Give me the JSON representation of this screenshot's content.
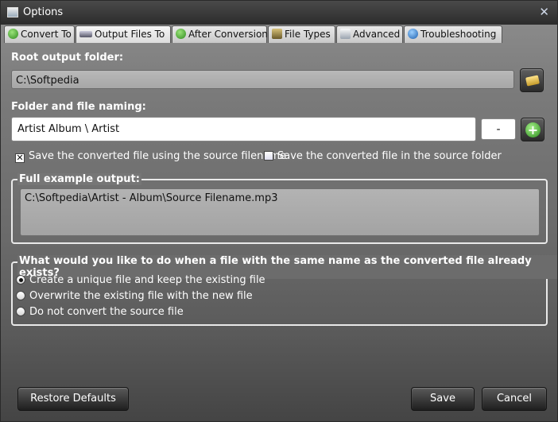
{
  "window": {
    "title": "Options",
    "close_glyph": "✕"
  },
  "tabs": [
    {
      "label": "Convert To",
      "icon": "green-check-icon"
    },
    {
      "label": "Output Files To",
      "icon": "car-icon",
      "active": true
    },
    {
      "label": "After Conversion",
      "icon": "green-check-icon"
    },
    {
      "label": "File Types",
      "icon": "gear-icon"
    },
    {
      "label": "Advanced",
      "icon": "document-icon"
    },
    {
      "label": "Troubleshooting",
      "icon": "help-icon"
    }
  ],
  "root_output": {
    "label": "Root output folder:",
    "value": "C:\\Softpedia"
  },
  "naming": {
    "label": "Folder and file naming:",
    "value": "Artist  Album  \\  Artist",
    "separator": "-"
  },
  "options": {
    "use_source_filename": "Save the converted file using the source filename",
    "use_source_filename_checked": true,
    "save_in_source_folder": "Save the converted file in the source folder",
    "save_in_source_folder_checked": false,
    "check_mark": "✕"
  },
  "example": {
    "title": "Full example output:",
    "value": "C:\\Softpedia\\Artist - Album\\Source Filename.mp3"
  },
  "conflict": {
    "title": "What would you like to do when a file with the same name as the converted file already exists?",
    "choices": [
      "Create a unique file and keep the existing file",
      "Overwrite the existing file with the new file",
      "Do not convert the source file"
    ],
    "selected_index": 0
  },
  "footer": {
    "restore": "Restore Defaults",
    "save": "Save",
    "cancel": "Cancel"
  }
}
